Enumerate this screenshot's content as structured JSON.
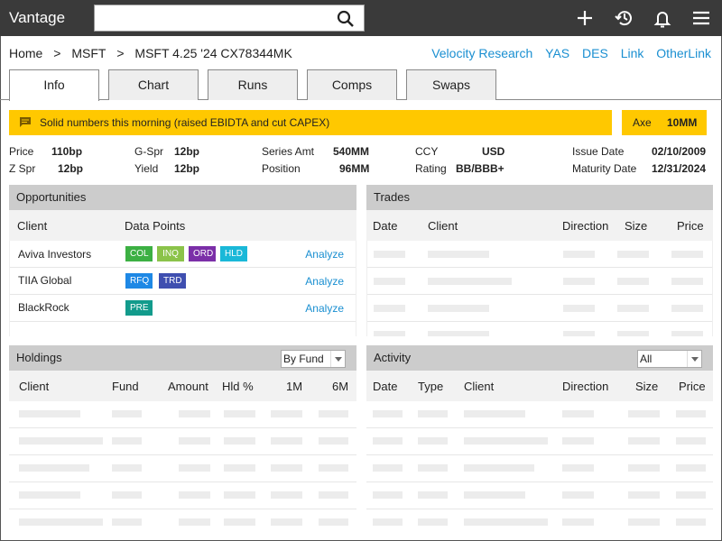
{
  "app": {
    "title": "Vantage"
  },
  "search": {
    "value": "",
    "placeholder": ""
  },
  "breadcrumb": [
    "Home",
    ">",
    "MSFT",
    ">",
    "MSFT 4.25 '24 CX78344MK"
  ],
  "top_links": [
    "Velocity Research",
    "YAS",
    "DES",
    "Link",
    "OtherLink"
  ],
  "tabs": [
    {
      "label": "Info",
      "active": true
    },
    {
      "label": "Chart",
      "active": false
    },
    {
      "label": "Runs",
      "active": false
    },
    {
      "label": "Comps",
      "active": false
    },
    {
      "label": "Swaps",
      "active": false
    }
  ],
  "alert": {
    "message": "Solid numbers this morning (raised EBIDTA and cut CAPEX)",
    "color": "#ffc800"
  },
  "axe": {
    "label": "Axe",
    "value": "10MM"
  },
  "info": [
    {
      "label": "Price",
      "value": "110bp"
    },
    {
      "label": "Z Spr",
      "value": "12bp"
    },
    {
      "label": "G-Spr",
      "value": "12bp"
    },
    {
      "label": "Yield",
      "value": "12bp"
    },
    {
      "label": "Series Amt",
      "value": "540MM"
    },
    {
      "label": "Position",
      "value": "96MM"
    },
    {
      "label": "CCY",
      "value": "USD"
    },
    {
      "label": "Rating",
      "value": "BB/BBB+"
    },
    {
      "label": "Issue Date",
      "value": "02/10/2009"
    },
    {
      "label": "Maturity Date",
      "value": "12/31/2024"
    }
  ],
  "opportunities": {
    "title": "Opportunities",
    "columns": [
      "Client",
      "Data Points"
    ],
    "action_label": "Analyze",
    "rows": [
      {
        "client": "Aviva Investors",
        "chips": [
          {
            "label": "COL",
            "color": "#3cb043"
          },
          {
            "label": "INQ",
            "color": "#8bc34a"
          },
          {
            "label": "ORD",
            "color": "#7b2fa8"
          },
          {
            "label": "HLD",
            "color": "#1ab8d8"
          }
        ]
      },
      {
        "client": "TIIA Global",
        "chips": [
          {
            "label": "RFQ",
            "color": "#1e88e5"
          },
          {
            "label": "TRD",
            "color": "#3f4fb0"
          }
        ]
      },
      {
        "client": "BlackRock",
        "chips": [
          {
            "label": "PRE",
            "color": "#129b8c"
          }
        ]
      }
    ]
  },
  "trades": {
    "title": "Trades",
    "columns": [
      "Date",
      "Client",
      "Direction",
      "Size",
      "Price"
    ]
  },
  "holdings": {
    "title": "Holdings",
    "filter": "By Fund",
    "columns": [
      "Client",
      "Fund",
      "Amount",
      "Hld %",
      "1M",
      "6M"
    ]
  },
  "activity": {
    "title": "Activity",
    "filter": "All",
    "columns": [
      "Date",
      "Type",
      "Client",
      "Direction",
      "Size",
      "Price"
    ]
  }
}
